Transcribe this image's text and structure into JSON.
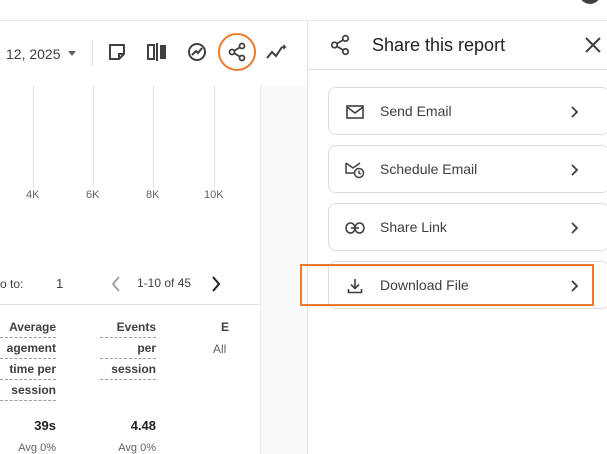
{
  "toolbar": {
    "date_fragment": "12, 2025",
    "icons": [
      "note-icon",
      "compare-icon",
      "insights-icon",
      "share-icon",
      "sparkline-icon"
    ]
  },
  "chart": {
    "x_ticks": [
      "4K",
      "6K",
      "8K",
      "10K"
    ]
  },
  "pager": {
    "goto_label": "o to:",
    "goto_value": "1",
    "range": "1-10 of 45"
  },
  "table": {
    "columns": [
      {
        "lines": [
          "Average",
          "agement",
          "time per",
          "session"
        ],
        "value": "39s",
        "sub": "Avg 0%"
      },
      {
        "lines": [
          "Events",
          "per",
          "session"
        ],
        "value": "4.48",
        "sub": "Avg 0%"
      },
      {
        "lines": [
          "E"
        ],
        "sub": "All"
      }
    ]
  },
  "share_panel": {
    "title": "Share this report",
    "options": [
      {
        "label": "Send Email",
        "icon": "mail-icon"
      },
      {
        "label": "Schedule Email",
        "icon": "schedule-email-icon"
      },
      {
        "label": "Share Link",
        "icon": "link-icon"
      },
      {
        "label": "Download File",
        "icon": "download-icon"
      }
    ]
  },
  "colors": {
    "highlight": "#f07a2a",
    "text": "#202124",
    "muted": "#5f6368",
    "border": "#dadce0"
  }
}
